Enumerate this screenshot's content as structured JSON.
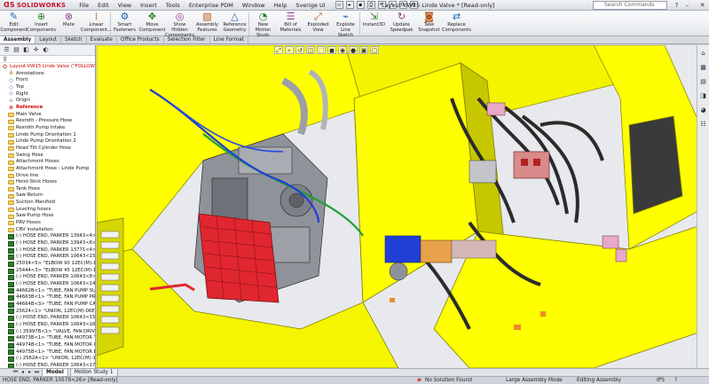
{
  "app": {
    "brand": "SOLIDWORKS",
    "title": "Layout-VW15 Linde Valve * [Read-only]"
  },
  "menu": [
    "File",
    "Edit",
    "View",
    "Insert",
    "Tools",
    "Enterprise PDM",
    "Window",
    "Help",
    "Sverige UI"
  ],
  "search": {
    "placeholder": "Search Commands"
  },
  "ribbon": [
    {
      "label": "Edit\nComponent",
      "icon": "edit-component-icon"
    },
    {
      "label": "Insert\nComponents",
      "icon": "insert-components-icon"
    },
    {
      "label": "Mate",
      "icon": "mate-icon"
    },
    {
      "label": "Linear\nComponent...",
      "icon": "linear-pattern-icon"
    },
    {
      "label": "Smart\nFasteners",
      "icon": "smart-fasteners-icon"
    },
    {
      "label": "Move\nComponent",
      "icon": "move-component-icon"
    },
    {
      "label": "Show\nHidden\nComponents",
      "icon": "show-hidden-icon"
    },
    {
      "label": "Assembly\nFeatures",
      "icon": "assembly-features-icon"
    },
    {
      "label": "Reference\nGeometry",
      "icon": "reference-geometry-icon"
    },
    {
      "label": "New\nMotion\nStudy",
      "icon": "motion-study-icon"
    },
    {
      "label": "Bill of\nMaterials",
      "icon": "bom-icon"
    },
    {
      "label": "Exploded\nView",
      "icon": "exploded-view-icon"
    },
    {
      "label": "Explode\nLine\nSketch",
      "icon": "explode-line-icon"
    },
    {
      "label": "Instant3D",
      "icon": "instant3d-icon"
    },
    {
      "label": "Update\nSpeedpak",
      "icon": "speedpak-icon"
    },
    {
      "label": "Take\nSnapshot",
      "icon": "snapshot-icon"
    },
    {
      "label": "Replace\nComponents",
      "icon": "replace-icon"
    }
  ],
  "tabs": [
    {
      "label": "Assembly",
      "active": true
    },
    {
      "label": "Layout",
      "active": false
    },
    {
      "label": "Sketch",
      "active": false
    },
    {
      "label": "Evaluate",
      "active": false
    },
    {
      "label": "Office Products",
      "active": false
    },
    {
      "label": "Selection Filter",
      "active": false
    },
    {
      "label": "Line Format",
      "active": false
    }
  ],
  "tree": [
    {
      "label": "Layout-VW15 Linde Valve  (\"FOLLOW",
      "kind": "root"
    },
    {
      "label": "Annotations",
      "kind": "annot"
    },
    {
      "label": "Front",
      "kind": "plane"
    },
    {
      "label": "Top",
      "kind": "plane"
    },
    {
      "label": "Right",
      "kind": "plane"
    },
    {
      "label": "Origin",
      "kind": "origin"
    },
    {
      "label": "Reference",
      "kind": "error"
    },
    {
      "label": "Main Valve",
      "kind": "folder"
    },
    {
      "label": "Rexroth - Pressure Hose",
      "kind": "folder"
    },
    {
      "label": "Rexroth Pump Intake",
      "kind": "folder"
    },
    {
      "label": "Linde Pump Orientation 1",
      "kind": "folder"
    },
    {
      "label": "Linde Pump Orientation 2",
      "kind": "folder"
    },
    {
      "label": "Head Tilt Cylinder Hose",
      "kind": "folder"
    },
    {
      "label": "Swing Hose",
      "kind": "folder"
    },
    {
      "label": "Attachment Hoses",
      "kind": "folder"
    },
    {
      "label": "Attachment Hose - Linde Pump",
      "kind": "folder"
    },
    {
      "label": "Drive line",
      "kind": "folder"
    },
    {
      "label": "Hoist-Stick Hoses",
      "kind": "folder"
    },
    {
      "label": "Tank Hose",
      "kind": "folder"
    },
    {
      "label": "Saw Return",
      "kind": "folder"
    },
    {
      "label": "Suction Manifold",
      "kind": "folder"
    },
    {
      "label": "Leveling hoses",
      "kind": "folder"
    },
    {
      "label": "Saw Pump Hose",
      "kind": "folder"
    },
    {
      "label": "PRV Hoses",
      "kind": "folder"
    },
    {
      "label": "CBV installation",
      "kind": "folder"
    },
    {
      "label": "(-) HOSE END, PARKER 13943<4> \"EL",
      "kind": "part"
    },
    {
      "label": "(-) HOSE END, PARKER 13943<6> \"EL",
      "kind": "part"
    },
    {
      "label": "(-) HOSE END, PARKER 13771<4> \"ELBO",
      "kind": "part"
    },
    {
      "label": "(-) HOSE END, PARKER 10643<15> \"CO",
      "kind": "part"
    },
    {
      "label": "25034<5> \"ELBOW 90 12EC(M)-12OF",
      "kind": "part"
    },
    {
      "label": "25444<3> \"ELBOW 45 12EC(M)-16OF",
      "kind": "part"
    },
    {
      "label": "(-) HOSE END, PARKER 10643<8> \"CO",
      "kind": "part"
    },
    {
      "label": "(-) HOSE END, PARKER 10643<14> \"C",
      "kind": "part"
    },
    {
      "label": "44662B<1> \"TUBE, FAN PUMP SUCTI",
      "kind": "part"
    },
    {
      "label": "44663B<1> \"TUBE, FAN PUMP PRESS",
      "kind": "part"
    },
    {
      "label": "44664B<3> \"TUBE, FAN PUMP CASE",
      "kind": "part"
    },
    {
      "label": "25624<1> \"UNION, 12EC(M)-06EC(M",
      "kind": "part"
    },
    {
      "label": "(-) HOSE END, PARKER 10643<15> \"COI",
      "kind": "part"
    },
    {
      "label": "(-) HOSE END, PARKER 10643<16> \"C",
      "kind": "part"
    },
    {
      "label": "(-) 35997B<1> \"VALVE, FAN DRIVE AS",
      "kind": "part"
    },
    {
      "label": "44973B<1> \"TUBE, FAN MOTOR TOP",
      "kind": "part"
    },
    {
      "label": "44974B<1> \"TUBE, FAN MOTOR CAS",
      "kind": "part"
    },
    {
      "label": "44975B<1> \"TUBE, FAN MOTOR BOT",
      "kind": "part"
    },
    {
      "label": "(-) 2562A<1> \"UNION, 12EC(M)-12EC",
      "kind": "part"
    },
    {
      "label": "(-) HOSE END, PARKER 10643<17> \"CO",
      "kind": "part"
    }
  ],
  "bottom_tabs": [
    {
      "label": "Model",
      "active": true
    },
    {
      "label": "Motion Study 1",
      "active": false
    }
  ],
  "status": {
    "left": "HOSE END, PARKER 10578<26> [Read-only]",
    "solution": "No Solution Found",
    "mode": "Large Assembly Mode",
    "editing": "Editing Assembly",
    "units": "IPS"
  },
  "colors": {
    "frame_yellow": "#ffff00",
    "frame_shadow": "#b9b900",
    "engine_gray": "#8f9299",
    "rack_red": "#e0262f",
    "hose_dark": "#2b2b2b",
    "pump_blue": "#1f3fd6",
    "tree_error": "#cc0000"
  }
}
